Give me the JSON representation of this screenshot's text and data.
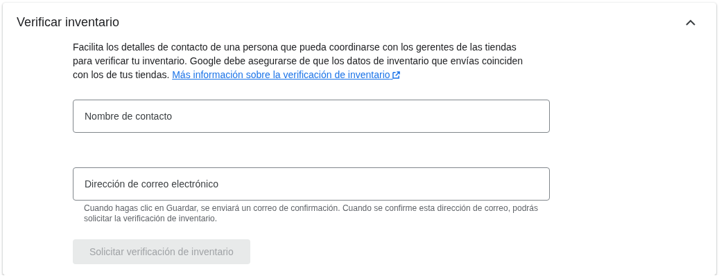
{
  "panel": {
    "title": "Verificar inventario",
    "expanded": true,
    "description": {
      "text": "Facilita los detalles de contacto de una persona que pueda coordinarse con los gerentes de las tiendas para verificar tu inventario. Google debe asegurarse de que los datos de inventario que envías coinciden con los de tus tiendas.",
      "link": "Más información sobre la verificación de inventario"
    },
    "fields": [
      {
        "placeholder": "Nombre de contacto"
      },
      {
        "placeholder": "Dirección de correo electrónico",
        "helper": "Cuando hagas clic en Guardar, se enviará un correo de confirmación. Cuando se confirme esta dirección de correo, podrás solicitar la verificación de inventario."
      }
    ],
    "button": {
      "label": "Solicitar verificación de inventario",
      "disabled": true
    }
  }
}
